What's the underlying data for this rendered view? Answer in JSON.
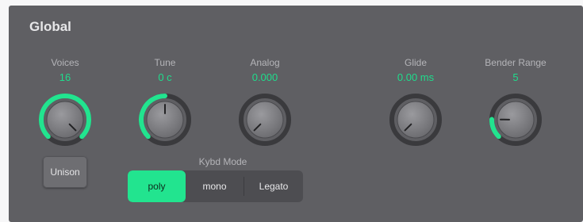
{
  "section_title": "Global",
  "params": [
    {
      "label": "Voices",
      "value": "16",
      "level": 1.0
    },
    {
      "label": "Tune",
      "value": "0 c",
      "level": 0.5
    },
    {
      "label": "Analog",
      "value": "0.000",
      "level": 0.0
    },
    {
      "label": "Glide",
      "value": "0.00 ms",
      "level": 0.0
    },
    {
      "label": "Bender Range",
      "value": "5",
      "level": 0.17
    }
  ],
  "unison_label": "Unison",
  "kybd_mode": {
    "label": "Kybd Mode",
    "options": [
      "poly",
      "mono",
      "Legato"
    ],
    "selected": "poly"
  },
  "colors": {
    "accent": "#22e48f",
    "panel": "#5f5f63",
    "knob_track": "#3a3a3d"
  }
}
